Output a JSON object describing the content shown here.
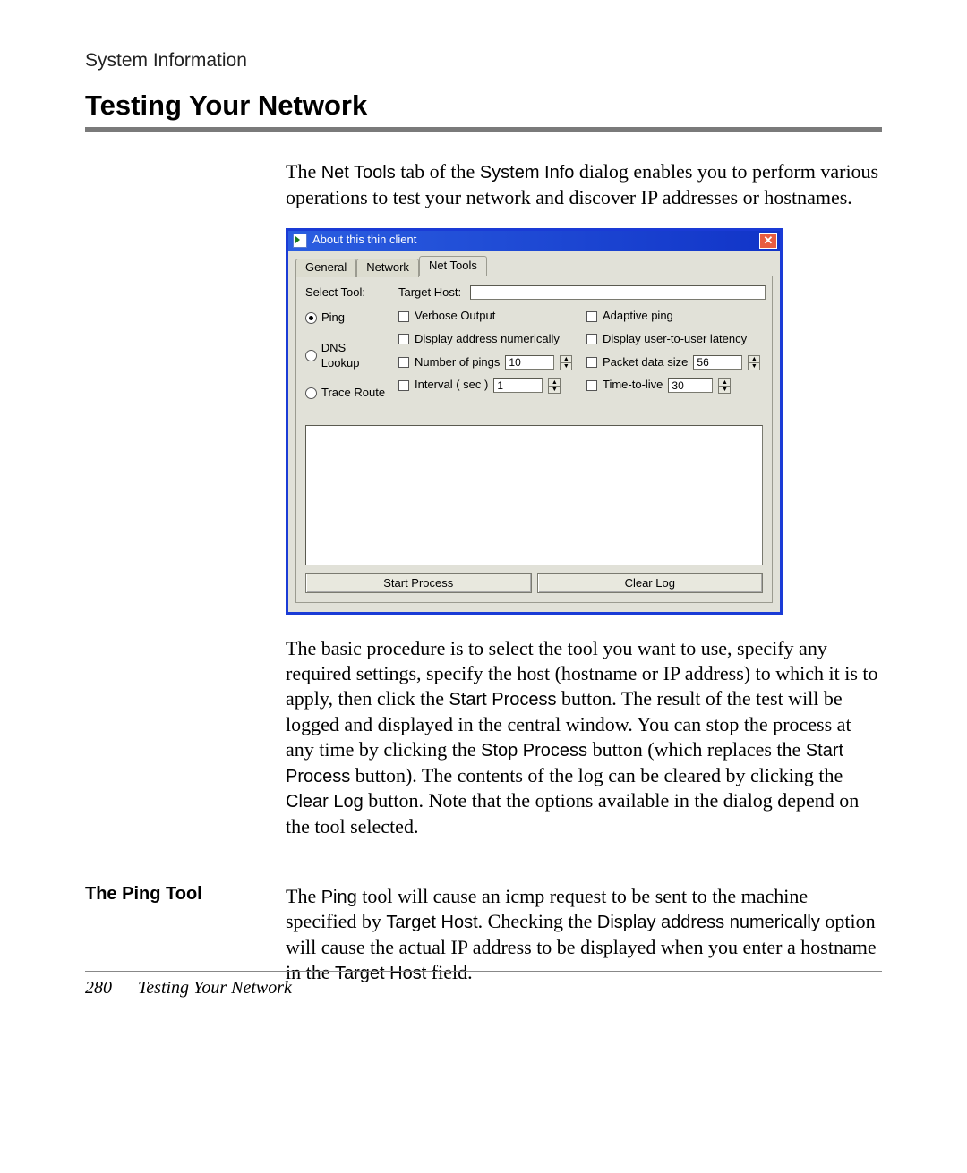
{
  "page": {
    "breadcrumb": "System Information",
    "heading": "Testing Your Network",
    "number": "280",
    "footer_title": "Testing Your Network"
  },
  "intro": {
    "t1": "The ",
    "k1": "Net Tools",
    "t2": " tab of the ",
    "k2": "System Info",
    "t3": " dialog enables you to perform various operations to test your network and discover IP addresses or hostnames."
  },
  "dialog": {
    "title": "About this thin client",
    "tabs": {
      "general": "General",
      "network": "Network",
      "nettools": "Net Tools"
    },
    "select_tool_label": "Select Tool:",
    "tools": {
      "ping": "Ping",
      "dns": "DNS Lookup",
      "trace": "Trace Route"
    },
    "target_host_label": "Target Host:",
    "target_host_value": "",
    "opts": {
      "verbose": "Verbose Output",
      "adaptive": "Adaptive ping",
      "numeric": "Display address numerically",
      "latency": "Display user-to-user latency",
      "count_label": "Number of pings",
      "count_value": "10",
      "size_label": "Packet data size",
      "size_value": "56",
      "interval_label": "Interval ( sec )",
      "interval_value": "1",
      "ttl_label": "Time-to-live",
      "ttl_value": "30"
    },
    "buttons": {
      "start": "Start Process",
      "clear": "Clear Log"
    }
  },
  "para2": {
    "t1": "The basic procedure is to select the tool you want to use, specify any required settings, specify the host (hostname or IP address) to which it is to apply, then click the ",
    "k1": "Start Process",
    "t2": " button. The result of the test will be logged and displayed in the central window. You can stop the process at any time by clicking the ",
    "k2": "Stop Process",
    "t3": " button (which replaces the ",
    "k3": "Start Process",
    "t4": " button). The contents of the log can be cleared by clicking the ",
    "k4": "Clear Log",
    "t5": " button. Note that the options available in the dialog depend on the tool selected."
  },
  "section2": {
    "label": "The Ping Tool",
    "t1": "The ",
    "k1": "Ping",
    "t2": " tool will cause an icmp request to be sent to the machine specified by ",
    "k2": "Target Host",
    "t3": ". Checking the ",
    "k3": "Display address numerically",
    "t4": " option will cause the actual IP address to be displayed when you enter a hostname in the ",
    "k4": "Target Host",
    "t5": " field."
  }
}
